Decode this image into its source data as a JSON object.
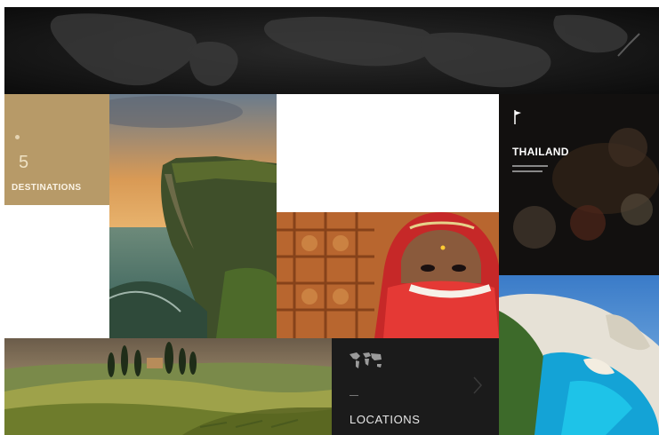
{
  "destinations_tile": {
    "count": "5",
    "label": "DESTINATIONS"
  },
  "thailand_tile": {
    "title": "THAILAND"
  },
  "locations_tile": {
    "label": "LOCATIONS"
  },
  "images": [
    "world-map-banner",
    "coastal-cliff-sunset-photo",
    "woman-in-red-veil-photo",
    "thailand-food-photo",
    "navagio-beach-photo",
    "tuscany-hills-photo"
  ],
  "colors": {
    "gold": "#b79a68",
    "dark": "#121212",
    "tile_dark": "#1b1b1b"
  }
}
